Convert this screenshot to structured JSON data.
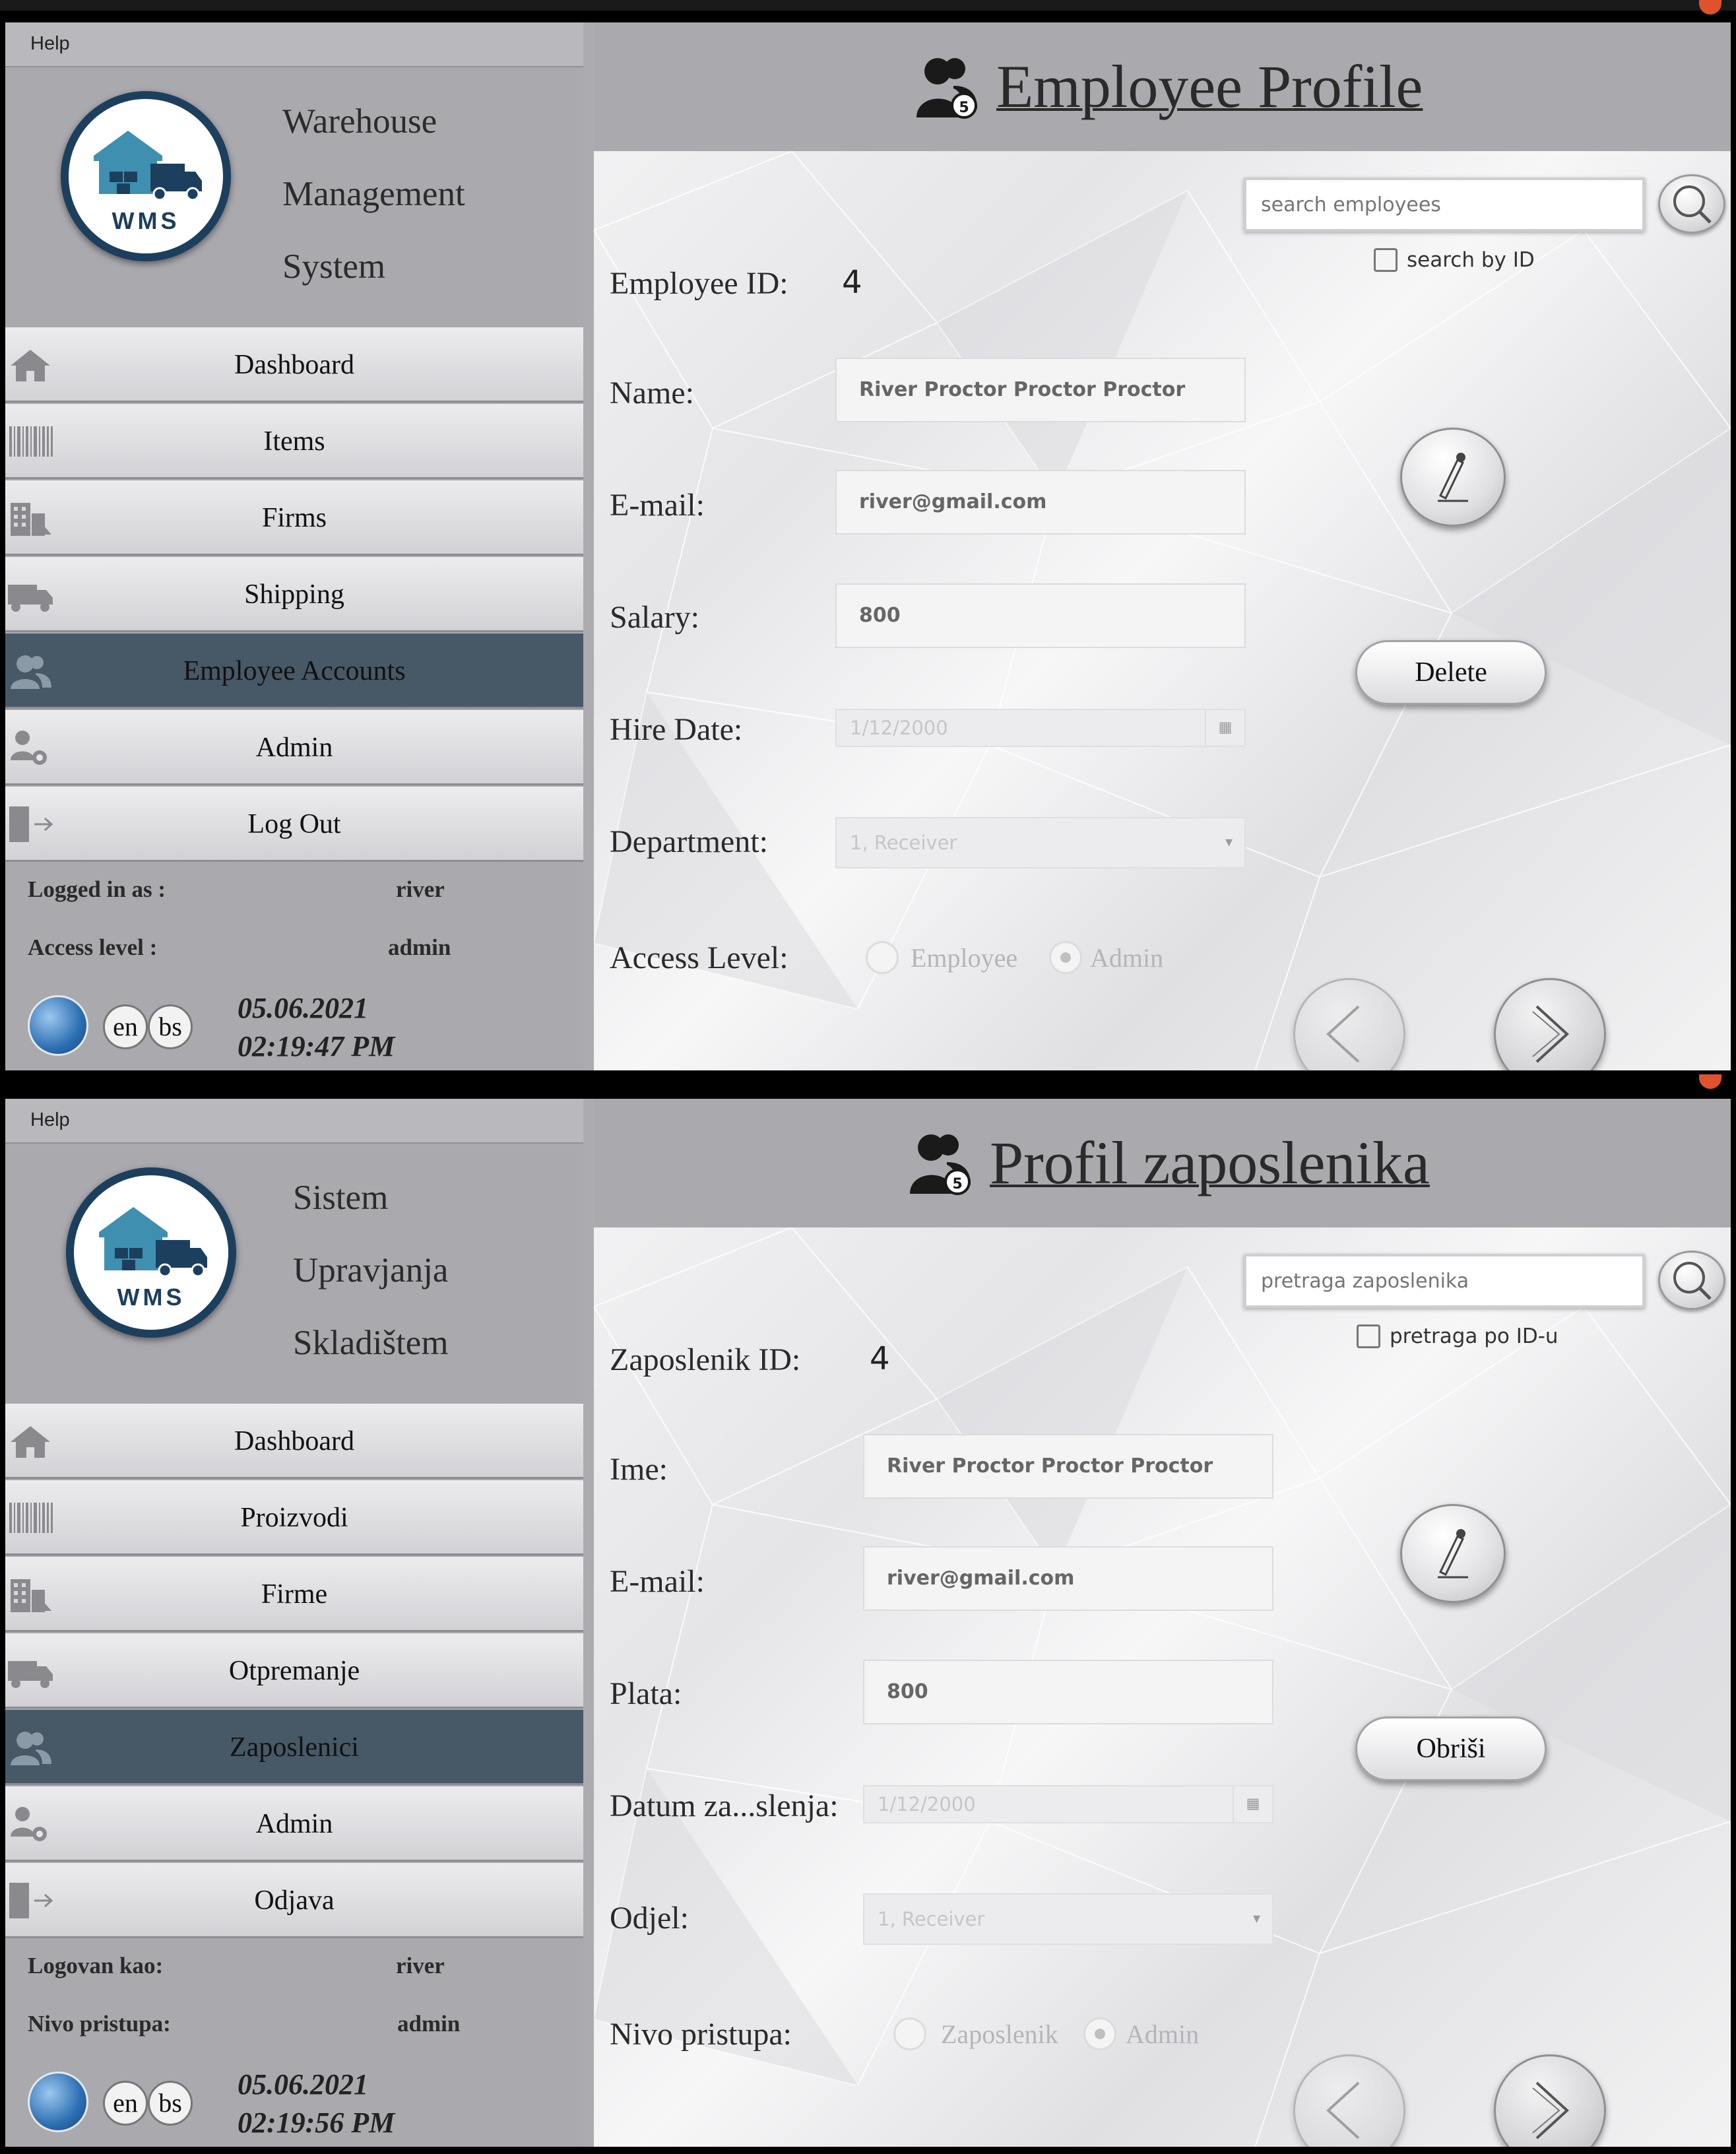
{
  "screens": [
    {
      "menu": {
        "help": "Help"
      },
      "app_title": [
        "Warehouse",
        "Management",
        "System"
      ],
      "logo_text": "WMS",
      "nav": [
        "Dashboard",
        "Items",
        "Firms",
        "Shipping",
        "Employee Accounts",
        "Admin",
        "Log Out"
      ],
      "nav_active": "Employee Accounts",
      "status": {
        "logged_in_label": "Logged in as :",
        "logged_in_value": "river",
        "access_label": "Access level :",
        "access_value": "admin"
      },
      "langs": [
        "en",
        "bs"
      ],
      "date": "05.06.2021",
      "time": "02:19:47 PM",
      "page_title": "Employee Profile",
      "search_placeholder": "search employees",
      "search_by_id": "search by ID",
      "labels": {
        "id": "Employee ID:",
        "name": "Name:",
        "email": "E-mail:",
        "salary": "Salary:",
        "hire_date": "Hire Date:",
        "department": "Department:",
        "access": "Access Level:"
      },
      "values": {
        "id": "4",
        "name": "River Proctor Proctor Proctor",
        "email": "river@gmail.com",
        "salary": "800",
        "hire_date": "1/12/2000",
        "department": "1, Receiver"
      },
      "radio": {
        "employee": "Employee",
        "admin": "Admin",
        "selected": "Admin"
      },
      "delete": "Delete"
    },
    {
      "menu": {
        "help": "Help"
      },
      "app_title": [
        "Sistem",
        "Upravjanja",
        "Skladištem"
      ],
      "logo_text": "WMS",
      "nav": [
        "Dashboard",
        "Proizvodi",
        "Firme",
        "Otpremanje",
        "Zaposlenici",
        "Admin",
        "Odjava"
      ],
      "nav_active": "Zaposlenici",
      "status": {
        "logged_in_label": "Logovan kao:",
        "logged_in_value": "river",
        "access_label": "Nivo pristupa:",
        "access_value": "admin"
      },
      "langs": [
        "en",
        "bs"
      ],
      "date": "05.06.2021",
      "time": "02:19:56 PM",
      "page_title": "Profil zaposlenika",
      "search_placeholder": "pretraga zaposlenika",
      "search_by_id": "pretraga po ID-u",
      "labels": {
        "id": "Zaposlenik ID:",
        "name": "Ime:",
        "email": "E-mail:",
        "salary": "Plata:",
        "hire_date": "Datum za...slenja:",
        "department": "Odjel:",
        "access": "Nivo pristupa:"
      },
      "values": {
        "id": "4",
        "name": "River Proctor Proctor Proctor",
        "email": "river@gmail.com",
        "salary": "800",
        "hire_date": "1/12/2000",
        "department": "1, Receiver"
      },
      "radio": {
        "employee": "Zaposlenik",
        "admin": "Admin",
        "selected": "Admin"
      },
      "delete": "Obriši"
    }
  ],
  "colors": {
    "accent_nav": "#475866",
    "logo": "#1d3f5e",
    "logo_teal": "#3f8fb0"
  },
  "icons": [
    "home-icon",
    "barcode-icon",
    "building-icon",
    "truck-icon",
    "users-icon",
    "user-gear-icon",
    "logout-icon",
    "globe-icon",
    "search-icon",
    "edit-pencil-icon",
    "prev-arrow-icon",
    "next-arrow-icon",
    "employee-profile-icon"
  ]
}
